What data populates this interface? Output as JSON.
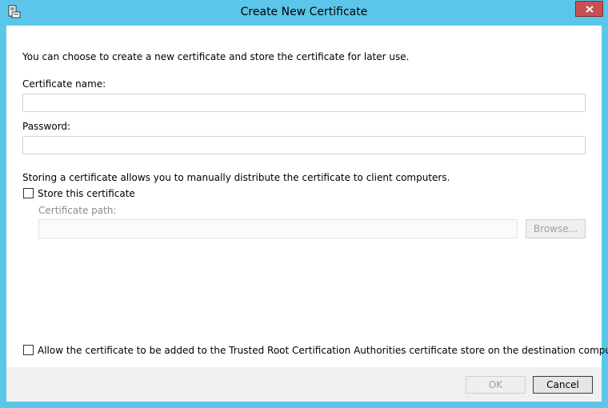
{
  "window": {
    "title": "Create New Certificate"
  },
  "intro": {
    "text": "You can choose to create a new certificate and store the certificate for later use."
  },
  "certificate_name": {
    "label": "Certificate name:",
    "value": ""
  },
  "password": {
    "label": "Password:",
    "value": ""
  },
  "store": {
    "description": "Storing a certificate allows you to manually distribute the certificate to client computers.",
    "checkbox_label": "Store this certificate",
    "checked": false,
    "path_label": "Certificate path:",
    "path_value": "",
    "browse_label": "Browse..."
  },
  "trusted_root": {
    "checkbox_label": "Allow the certificate to be added to the Trusted Root Certification Authorities certificate store on the destination computers",
    "checked": false
  },
  "buttons": {
    "ok_label": "OK",
    "cancel_label": "Cancel"
  },
  "icons": {
    "app": "certificate-app-icon",
    "close": "close-icon"
  },
  "colors": {
    "titlebar": "#5bc6ea",
    "close": "#c75050"
  }
}
